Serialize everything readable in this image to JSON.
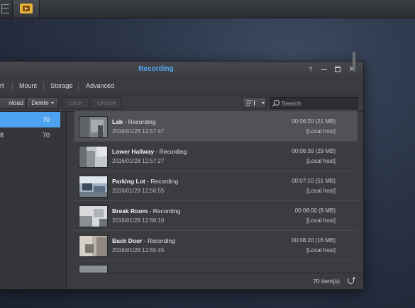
{
  "window": {
    "title": "Recording"
  },
  "menu": {
    "items": [
      "rt",
      "Mount",
      "Storage",
      "Advanced"
    ]
  },
  "toolbar": {
    "download_label": "nload",
    "delete_label": "Delete",
    "lock_label": "Lock",
    "unlock_label": "Unlock",
    "search_placeholder": "Search"
  },
  "left_list": [
    {
      "name": "",
      "count": "70"
    },
    {
      "name": "8",
      "count": "70"
    }
  ],
  "recordings": [
    {
      "name": "Lab",
      "status": " - Recording",
      "time": "2016/01/28 12:57:47",
      "duration": "00:06:20 (21 MB)",
      "host": "[Local host]"
    },
    {
      "name": "Lower Hallway",
      "status": " - Recording",
      "time": "2016/01/28 12:57:27",
      "duration": "00:06:39 (29 MB)",
      "host": "[Local host]"
    },
    {
      "name": "Parking Lot",
      "status": " - Recording",
      "time": "2016/01/28 12:56:55",
      "duration": "00:07:10 (51 MB)",
      "host": "[Local host]"
    },
    {
      "name": "Break Room",
      "status": " - Recording",
      "time": "2016/01/28 12:56:10",
      "duration": "00:08:00 (9 MB)",
      "host": "[Local host]"
    },
    {
      "name": "Back Door",
      "status": " - Recording",
      "time": "2016/01/28 12:55:45",
      "duration": "00:08:20 (16 MB)",
      "host": "[Local host]"
    }
  ],
  "footer": {
    "item_count": "70 item(s)"
  },
  "colors": {
    "accent": "#4da3f0",
    "title": "#52a8f5",
    "window_bg": "#3a3c40",
    "selected_row": "#505257"
  },
  "icons": [
    "grid-icon",
    "surveillance-app-icon",
    "help-icon",
    "minimize-icon",
    "maximize-icon",
    "close-icon",
    "sort-icon",
    "search-icon",
    "refresh-icon"
  ]
}
